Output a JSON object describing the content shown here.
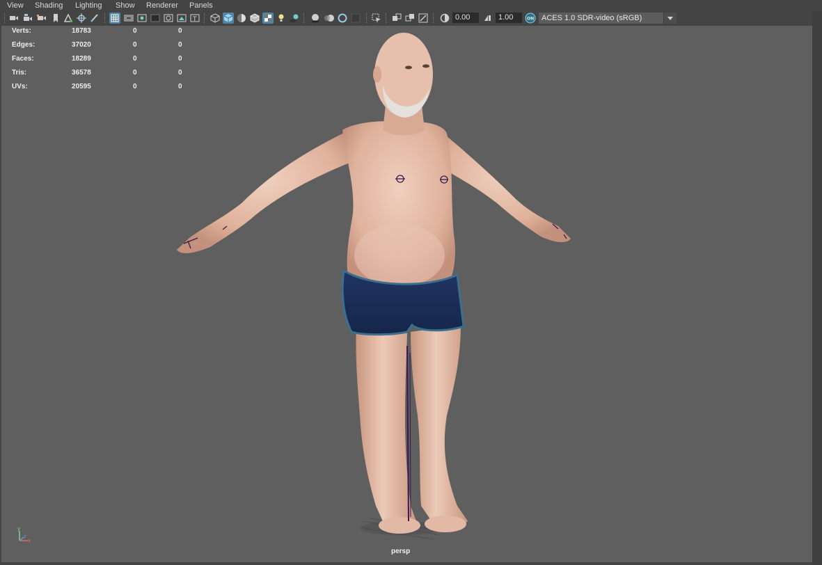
{
  "menu": [
    "View",
    "Shading",
    "Lighting",
    "Show",
    "Renderer",
    "Panels"
  ],
  "toolbar": {
    "exposure_value": "0.00",
    "gamma_value": "1.00",
    "color_management_on_label": "ON",
    "color_space": "ACES 1.0 SDR-video (sRGB)"
  },
  "hud": {
    "rows": [
      {
        "label": "Verts:",
        "value": "18783",
        "a": "0",
        "b": "0"
      },
      {
        "label": "Edges:",
        "value": "37020",
        "a": "0",
        "b": "0"
      },
      {
        "label": "Faces:",
        "value": "18289",
        "a": "0",
        "b": "0"
      },
      {
        "label": "Tris:",
        "value": "36578",
        "a": "0",
        "b": "0"
      },
      {
        "label": "UVs:",
        "value": "20595",
        "a": "0",
        "b": "0"
      }
    ]
  },
  "viewport": {
    "camera": "persp",
    "background_color": "#5f5f5f",
    "axis_labels": {
      "y": "y",
      "z": "z",
      "x": "x"
    }
  },
  "colors": {
    "skin": "#e8c1ae",
    "shorts": "#1d2f57",
    "shorts_trim": "#3b6f8e",
    "joint_markers": "#3a1a4e",
    "active_button": "#5285a6"
  }
}
